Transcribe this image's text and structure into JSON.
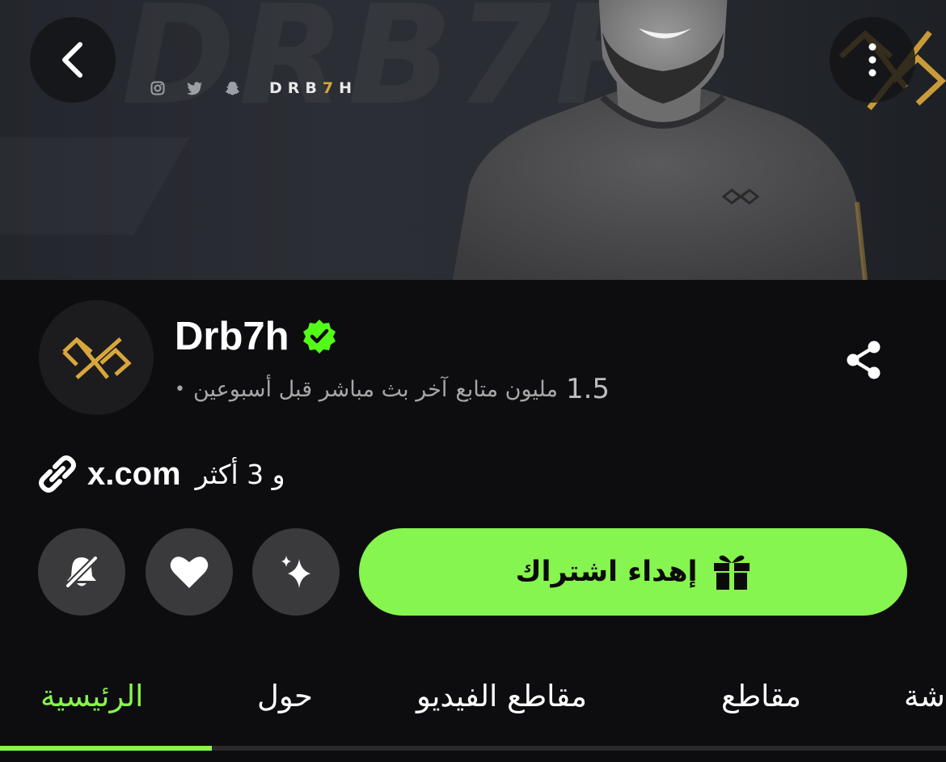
{
  "banner": {
    "brand_prefix": "DRB",
    "brand_digit": "7",
    "brand_suffix": "H",
    "watermark_text": "DRB7H",
    "social_icons": [
      "instagram-icon",
      "twitter-icon",
      "snapchat-icon"
    ],
    "accent_color": "#d9a63c"
  },
  "header": {
    "back_icon": "chevron-left-icon",
    "more_icon": "more-vertical-icon"
  },
  "channel": {
    "name": "Drb7h",
    "verified": true,
    "verified_color": "#53fc18",
    "followers_count": "1.5",
    "followers_label": "مليون متابع",
    "last_live": "آخر بث مباشر قبل أسبوعين",
    "bullet": "•",
    "link_text": "x.com",
    "more_links": "و 3 أكثر"
  },
  "actions": {
    "notifications_icon": "bell-off-icon",
    "follow_icon": "heart-icon",
    "subscribe_icon": "sparkle-icon",
    "gift_label": "إهداء اشتراك",
    "gift_icon": "gift-icon",
    "primary_color": "#86f54f"
  },
  "tabs": [
    {
      "label": "الرئيسية",
      "active": true
    },
    {
      "label": "حول",
      "active": false
    },
    {
      "label": "مقاطع الفيديو",
      "active": false
    },
    {
      "label": "مقاطع",
      "active": false
    },
    {
      "label": "شة",
      "active": false
    }
  ]
}
